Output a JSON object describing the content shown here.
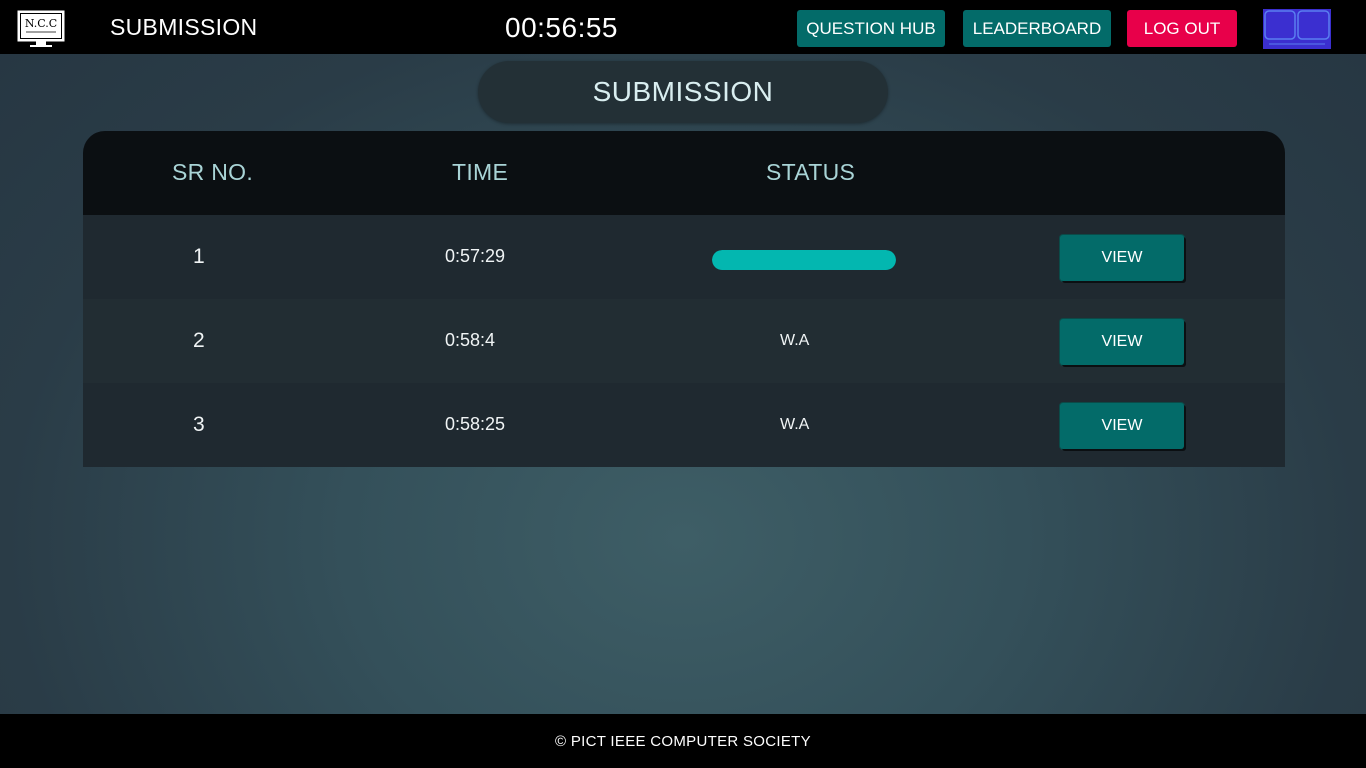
{
  "header": {
    "logo_text": "N.C.C",
    "page_title": "SUBMISSION",
    "timer": "00:56:55",
    "question_hub_label": "QUESTION HUB",
    "leaderboard_label": "LEADERBOARD",
    "logout_label": "LOG OUT"
  },
  "colors": {
    "header_bg": "#000000",
    "teal_button": "#036b69",
    "logout_button": "#e8004a",
    "progress_fill": "#03b7b0",
    "ieee_logo": "#3b2fd0"
  },
  "main": {
    "title": "SUBMISSION",
    "table": {
      "columns": [
        "SR NO.",
        "TIME",
        "STATUS",
        ""
      ],
      "rows": [
        {
          "sr": "1",
          "time": "0:57:29",
          "status": "",
          "status_progress": 1.0,
          "action": "VIEW"
        },
        {
          "sr": "2",
          "time": "0:58:4",
          "status": "W.A",
          "action": "VIEW"
        },
        {
          "sr": "3",
          "time": "0:58:25",
          "status": "W.A",
          "action": "VIEW"
        }
      ]
    }
  },
  "footer": {
    "text": "© PICT IEEE COMPUTER SOCIETY"
  }
}
